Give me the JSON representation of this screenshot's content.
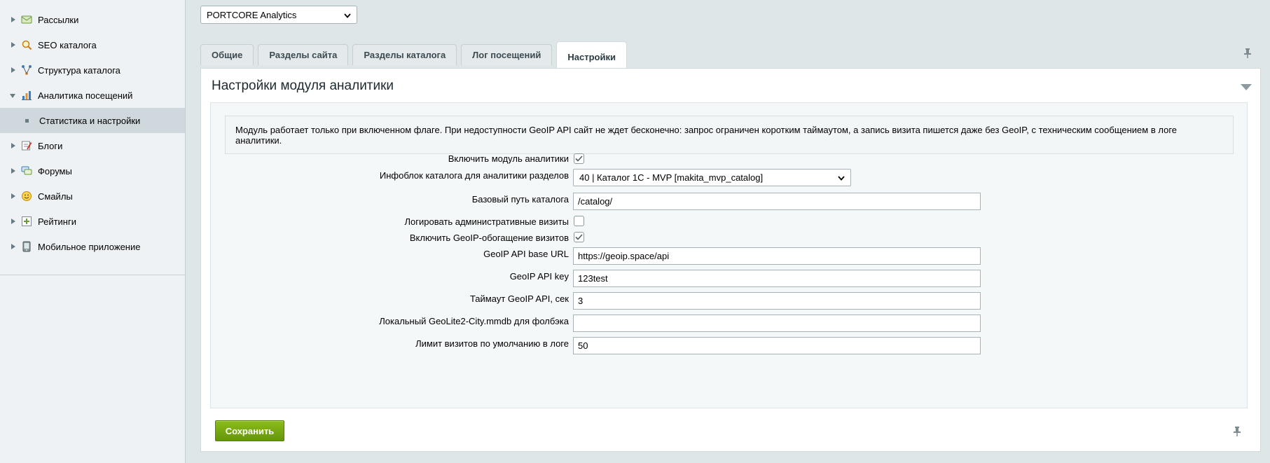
{
  "sidebar": {
    "items": [
      {
        "label": "Рассылки",
        "icon": "mail-icon"
      },
      {
        "label": "SEO каталога",
        "icon": "seo-search-icon"
      },
      {
        "label": "Структура каталога",
        "icon": "structure-tree-icon"
      },
      {
        "label": "Аналитика посещений",
        "icon": "analytics-chart-icon"
      },
      {
        "label": "Статистика и настройки",
        "icon": "bullet-icon"
      },
      {
        "label": "Блоги",
        "icon": "blog-icon"
      },
      {
        "label": "Форумы",
        "icon": "forum-icon"
      },
      {
        "label": "Смайлы",
        "icon": "smile-icon"
      },
      {
        "label": "Рейтинги",
        "icon": "rating-icon"
      },
      {
        "label": "Мобильное приложение",
        "icon": "mobile-icon"
      }
    ]
  },
  "site_select": {
    "value": "PORTCORE Analytics"
  },
  "tabs": [
    {
      "label": "Общие"
    },
    {
      "label": "Разделы сайта"
    },
    {
      "label": "Разделы каталога"
    },
    {
      "label": "Лог посещений"
    },
    {
      "label": "Настройки"
    }
  ],
  "panel": {
    "title": "Настройки модуля аналитики",
    "notice": "Модуль работает только при включенном флаге. При недоступности GeoIP API сайт не ждет бесконечно: запрос ограничен коротким таймаутом, а запись визита пишется даже без GeoIP, с техническим сообщением в логе аналитики."
  },
  "form": {
    "enable_module": {
      "label": "Включить модуль аналитики",
      "checked": true
    },
    "iblock": {
      "label": "Инфоблок каталога для аналитики разделов",
      "value": "40 | Каталог 1С - MVP [makita_mvp_catalog]"
    },
    "base_path": {
      "label": "Базовый путь каталога",
      "value": "/catalog/"
    },
    "log_admin": {
      "label": "Логировать административные визиты",
      "checked": false
    },
    "geoip_enrich": {
      "label": "Включить GeoIP-обогащение визитов",
      "checked": true
    },
    "geoip_url": {
      "label": "GeoIP API base URL",
      "value": "https://geoip.space/api"
    },
    "geoip_key": {
      "label": "GeoIP API key",
      "value": "123test"
    },
    "geoip_timeout": {
      "label": "Таймаут GeoIP API, сек",
      "value": "3"
    },
    "geolite_path": {
      "label": "Локальный GeoLite2-City.mmdb для фолбэка",
      "value": ""
    },
    "visit_limit": {
      "label": "Лимит визитов по умолчанию в логе",
      "value": "50"
    }
  },
  "buttons": {
    "save": "Сохранить"
  }
}
